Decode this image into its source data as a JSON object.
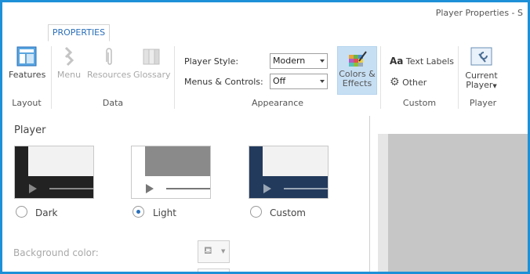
{
  "window": {
    "title": "Player Properties - S"
  },
  "tabs": [
    {
      "label": "PROPERTIES",
      "active": true
    }
  ],
  "ribbon": {
    "layout": {
      "group_label": "Layout",
      "features_label": "Features"
    },
    "data": {
      "group_label": "Data",
      "menu_label": "Menu",
      "resources_label": "Resources",
      "glossary_label": "Glossary"
    },
    "appearance": {
      "group_label": "Appearance",
      "player_style_label": "Player Style:",
      "player_style_value": "Modern",
      "menus_controls_label": "Menus & Controls:",
      "menus_controls_value": "Off",
      "colors_line1": "Colors &",
      "colors_line2": "Effects"
    },
    "custom": {
      "group_label": "Custom",
      "text_labels_prefix": "Aa",
      "text_labels": "Text Labels",
      "other": "Other"
    },
    "player": {
      "group_label": "Player",
      "current_line1": "Current",
      "current_line2": "Player"
    }
  },
  "panel": {
    "heading": "Player",
    "themes": [
      {
        "label": "Dark",
        "selected": false
      },
      {
        "label": "Light",
        "selected": true
      },
      {
        "label": "Custom",
        "selected": false
      }
    ],
    "background_color_label": "Background color:"
  },
  "colors": {
    "accent": "#1e90d8",
    "dark_theme": "#222222",
    "custom_theme": "#223a5c",
    "selected_button": "#c7dff3"
  }
}
